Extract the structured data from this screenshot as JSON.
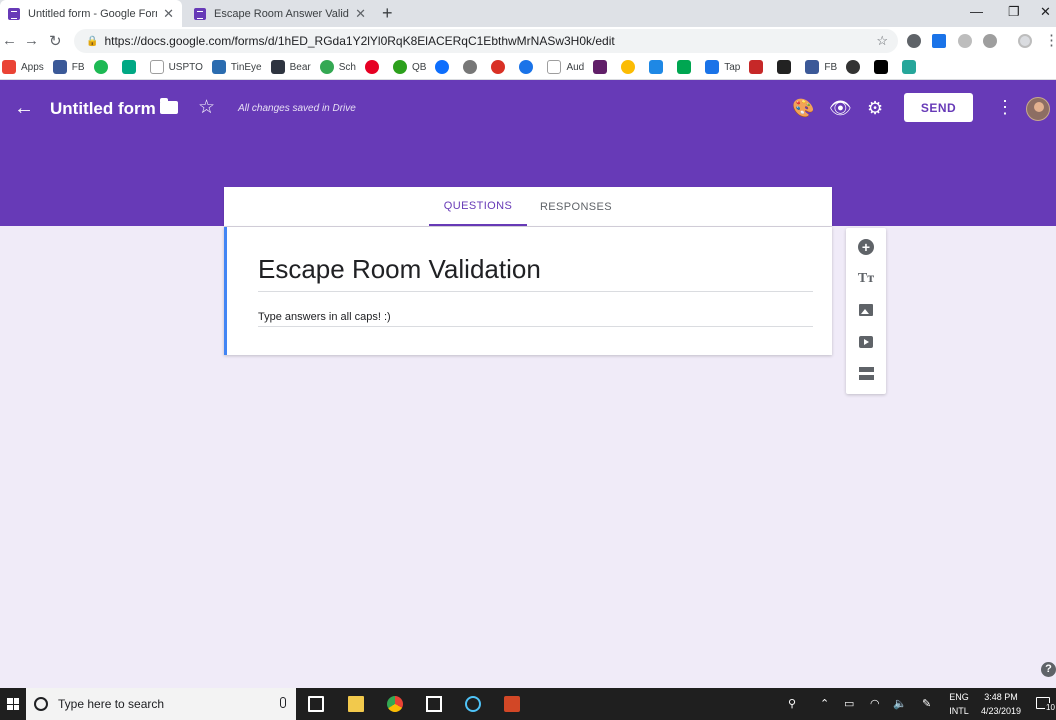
{
  "browser": {
    "tabs": [
      {
        "title": "Untitled form - Google Forms",
        "active": true
      },
      {
        "title": "Escape Room Answer Validation",
        "active": false
      }
    ],
    "new_tab": "+",
    "url": "https://docs.google.com/forms/d/1hED_RGda1Y2lYl0RqK8ElACERqC1EbthwMrNASw3H0k/edit"
  },
  "bookmarks": [
    {
      "label": "Apps",
      "color": "#ea4335"
    },
    {
      "label": "FB",
      "color": "#3b5998"
    },
    {
      "label": "",
      "color": "#1db954"
    },
    {
      "label": "",
      "color": "#00a884"
    },
    {
      "label": "USPTO",
      "color": "#9e9e9e"
    },
    {
      "label": "TinEye",
      "color": "#2b6cb0"
    },
    {
      "label": "Bear",
      "color": "#2e3440"
    },
    {
      "label": "Sch",
      "color": "#34a853"
    },
    {
      "label": "",
      "color": "#e60023"
    },
    {
      "label": "QB",
      "color": "#2ca01c"
    },
    {
      "label": "",
      "color": "#0d6efd"
    },
    {
      "label": "",
      "color": "#777777"
    },
    {
      "label": "",
      "color": "#d93025"
    },
    {
      "label": "",
      "color": "#1a73e8"
    },
    {
      "label": "Aud",
      "color": "#9e9e9e"
    },
    {
      "label": "",
      "color": "#611f69"
    },
    {
      "label": "",
      "color": "#fbbc04"
    },
    {
      "label": "",
      "color": "#1e88e5"
    },
    {
      "label": "",
      "color": "#00a651"
    },
    {
      "label": "Tap",
      "color": "#1a73e8"
    },
    {
      "label": "",
      "color": "#c62828"
    },
    {
      "label": "",
      "color": "#222222"
    },
    {
      "label": "FB",
      "color": "#3b5998"
    },
    {
      "label": "",
      "color": "#333333"
    },
    {
      "label": "",
      "color": "#000000"
    },
    {
      "label": "",
      "color": "#26a69a"
    }
  ],
  "header": {
    "title": "Untitled form",
    "saved_status": "All changes saved in Drive",
    "send_label": "SEND",
    "accent": "#673ab7"
  },
  "form_tabs": {
    "questions": "QUESTIONS",
    "responses": "RESPONSES"
  },
  "form": {
    "title": "Escape Room Validation",
    "description": "Type answers in all caps! :)"
  },
  "taskbar": {
    "search_placeholder": "Type here to search",
    "lang_top": "ENG",
    "lang_bottom": "INTL",
    "time": "3:48 PM",
    "date": "4/23/2019",
    "notifications": "10"
  }
}
